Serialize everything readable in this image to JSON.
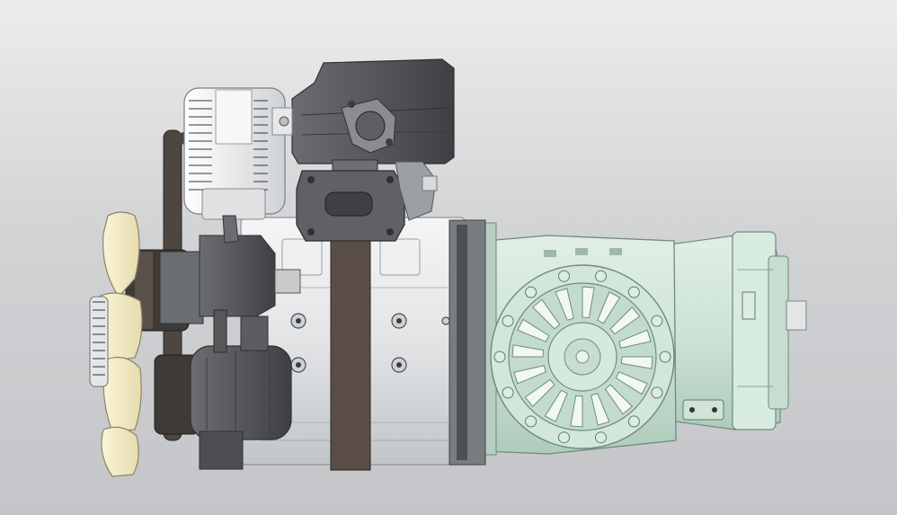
{
  "scene": {
    "background_top": "#ececec",
    "background_bottom": "#c3c5c8",
    "colors": {
      "engine_body": "#e4e6e8",
      "engine_shade": "#bfc3c6",
      "belt": "#4e4641",
      "dark_part": "#56585b",
      "dark_part_edge": "#2f3133",
      "transmission": "#cde3d6",
      "transmission_edge": "#6f8a7d",
      "fan": "#f2eac6",
      "fan_edge": "#8c8460"
    },
    "parts": [
      {
        "name": "cooling-fan"
      },
      {
        "name": "alternator"
      },
      {
        "name": "drive-belt"
      },
      {
        "name": "intake-manifold"
      },
      {
        "name": "rotary-engine-block"
      },
      {
        "name": "power-steering-pump"
      },
      {
        "name": "ac-compressor"
      },
      {
        "name": "transmission-bellhousing"
      },
      {
        "name": "gearbox-tailhousing"
      }
    ]
  }
}
